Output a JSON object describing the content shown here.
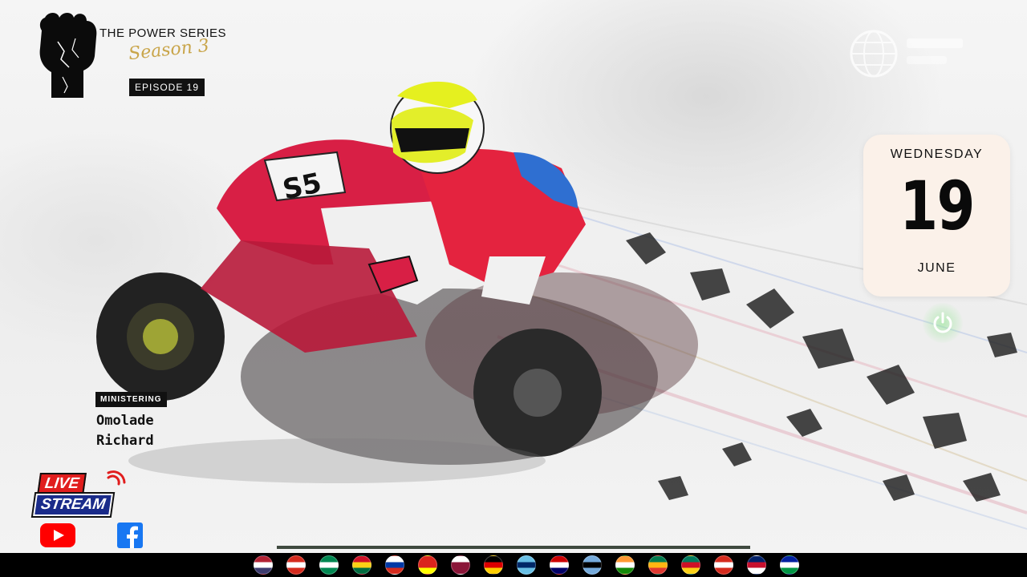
{
  "branding": {
    "series_title": "THE POWER SERIES",
    "season": "Season 3",
    "episode": "EPISODE 19"
  },
  "date_card": {
    "weekday": "WEDNESDAY",
    "day": "19",
    "month": "JUNE"
  },
  "ministering": {
    "label": "MINISTERING",
    "name_line1": "Omolade",
    "name_line2": "Richard"
  },
  "live_badge": {
    "live": "LIVE",
    "stream": "STREAM"
  },
  "social": [
    {
      "name": "youtube-icon",
      "color": "#ff0000"
    },
    {
      "name": "facebook-icon",
      "color": "#1877f2"
    }
  ],
  "flags": [
    {
      "country": "united-states",
      "colors": [
        "#b22234",
        "#ffffff",
        "#3c3b6e"
      ]
    },
    {
      "country": "canada",
      "colors": [
        "#d52b1e",
        "#ffffff",
        "#d52b1e"
      ]
    },
    {
      "country": "nigeria",
      "colors": [
        "#008751",
        "#ffffff",
        "#008751"
      ]
    },
    {
      "country": "ghana",
      "colors": [
        "#ce1126",
        "#fcd116",
        "#006b3f"
      ]
    },
    {
      "country": "russia",
      "colors": [
        "#ffffff",
        "#0039a6",
        "#d52b1e"
      ]
    },
    {
      "country": "vietnam",
      "colors": [
        "#da251d",
        "#da251d",
        "#ffff00"
      ]
    },
    {
      "country": "qatar",
      "colors": [
        "#ffffff",
        "#8a1538",
        "#8a1538"
      ]
    },
    {
      "country": "germany",
      "colors": [
        "#000000",
        "#dd0000",
        "#ffce00"
      ]
    },
    {
      "country": "fiji",
      "colors": [
        "#68bfe5",
        "#002868",
        "#68bfe5"
      ]
    },
    {
      "country": "malaysia",
      "colors": [
        "#cc0001",
        "#ffffff",
        "#010066"
      ]
    },
    {
      "country": "botswana",
      "colors": [
        "#75aadb",
        "#000000",
        "#75aadb"
      ]
    },
    {
      "country": "india",
      "colors": [
        "#ff9933",
        "#ffffff",
        "#138808"
      ]
    },
    {
      "country": "south-africa",
      "colors": [
        "#007a4d",
        "#ffb612",
        "#de3831"
      ]
    },
    {
      "country": "cameroon",
      "colors": [
        "#007a5e",
        "#ce1126",
        "#fcd116"
      ]
    },
    {
      "country": "canada",
      "colors": [
        "#d52b1e",
        "#ffffff",
        "#d52b1e"
      ]
    },
    {
      "country": "united-kingdom",
      "colors": [
        "#012169",
        "#c8102e",
        "#ffffff"
      ]
    },
    {
      "country": "lesotho",
      "colors": [
        "#00209f",
        "#ffffff",
        "#009543"
      ]
    }
  ],
  "accent_colors": {
    "season_gold": "#c9a54a",
    "live_red": "#e11d1d",
    "stream_blue": "#1a2b8a",
    "power_green": "#8ee68e",
    "date_card_bg": "#fbf1e9"
  }
}
